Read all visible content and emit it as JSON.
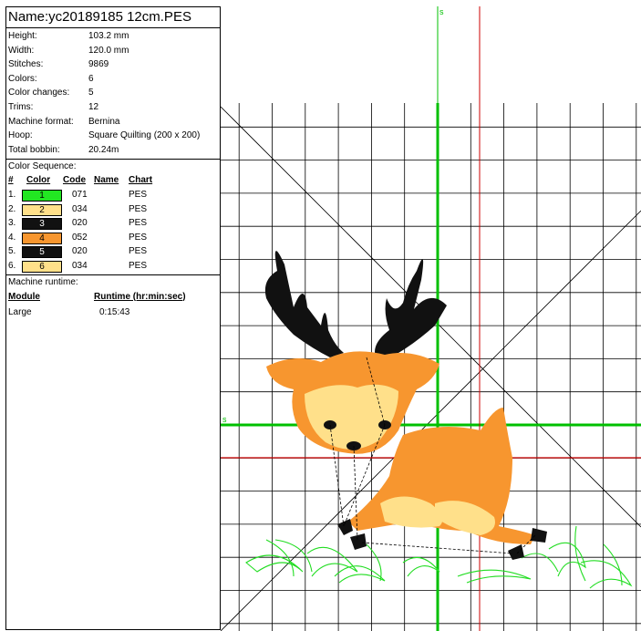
{
  "file_name": "Name:yc20189185 12cm.PES",
  "properties": [
    {
      "label": "Height:",
      "value": "103.2 mm"
    },
    {
      "label": "Width:",
      "value": "120.0 mm"
    },
    {
      "label": "Stitches:",
      "value": "9869"
    },
    {
      "label": "Colors:",
      "value": "6"
    },
    {
      "label": "Color changes:",
      "value": "5"
    },
    {
      "label": "Trims:",
      "value": "12"
    },
    {
      "label": "Machine format:",
      "value": "Bernina"
    },
    {
      "label": "Hoop:",
      "value": "Square Quilting (200 x 200)"
    },
    {
      "label": "Total bobbin:",
      "value": "20.24m"
    }
  ],
  "color_sequence": {
    "title": "Color Sequence:",
    "headers": {
      "num": "#",
      "color": "Color",
      "code": "Code",
      "name": "Name",
      "chart": "Chart"
    },
    "rows": [
      {
        "idx": "1.",
        "swatch": "1",
        "color": "#22e622",
        "text_color": "#000000",
        "code": "071",
        "name": "",
        "chart": "PES"
      },
      {
        "idx": "2.",
        "swatch": "2",
        "color": "#ffe08a",
        "text_color": "#000000",
        "code": "034",
        "name": "",
        "chart": "PES"
      },
      {
        "idx": "3.",
        "swatch": "3",
        "color": "#111111",
        "text_color": "#ffffff",
        "code": "020",
        "name": "",
        "chart": "PES"
      },
      {
        "idx": "4.",
        "swatch": "4",
        "color": "#f7962f",
        "text_color": "#000000",
        "code": "052",
        "name": "",
        "chart": "PES"
      },
      {
        "idx": "5.",
        "swatch": "5",
        "color": "#111111",
        "text_color": "#ffffff",
        "code": "020",
        "name": "",
        "chart": "PES"
      },
      {
        "idx": "6.",
        "swatch": "6",
        "color": "#ffe08a",
        "text_color": "#000000",
        "code": "034",
        "name": "",
        "chart": "PES"
      }
    ]
  },
  "runtime": {
    "title": "Machine runtime:",
    "module_header": "Module",
    "runtime_header": "Runtime (hr:min:sec)",
    "module": "Large",
    "time": "0:15:43"
  },
  "canvas": {
    "start_marker": "s",
    "axis_color": "#00c000",
    "ruler_color": "#cc0000",
    "grid_color": "#000000"
  }
}
